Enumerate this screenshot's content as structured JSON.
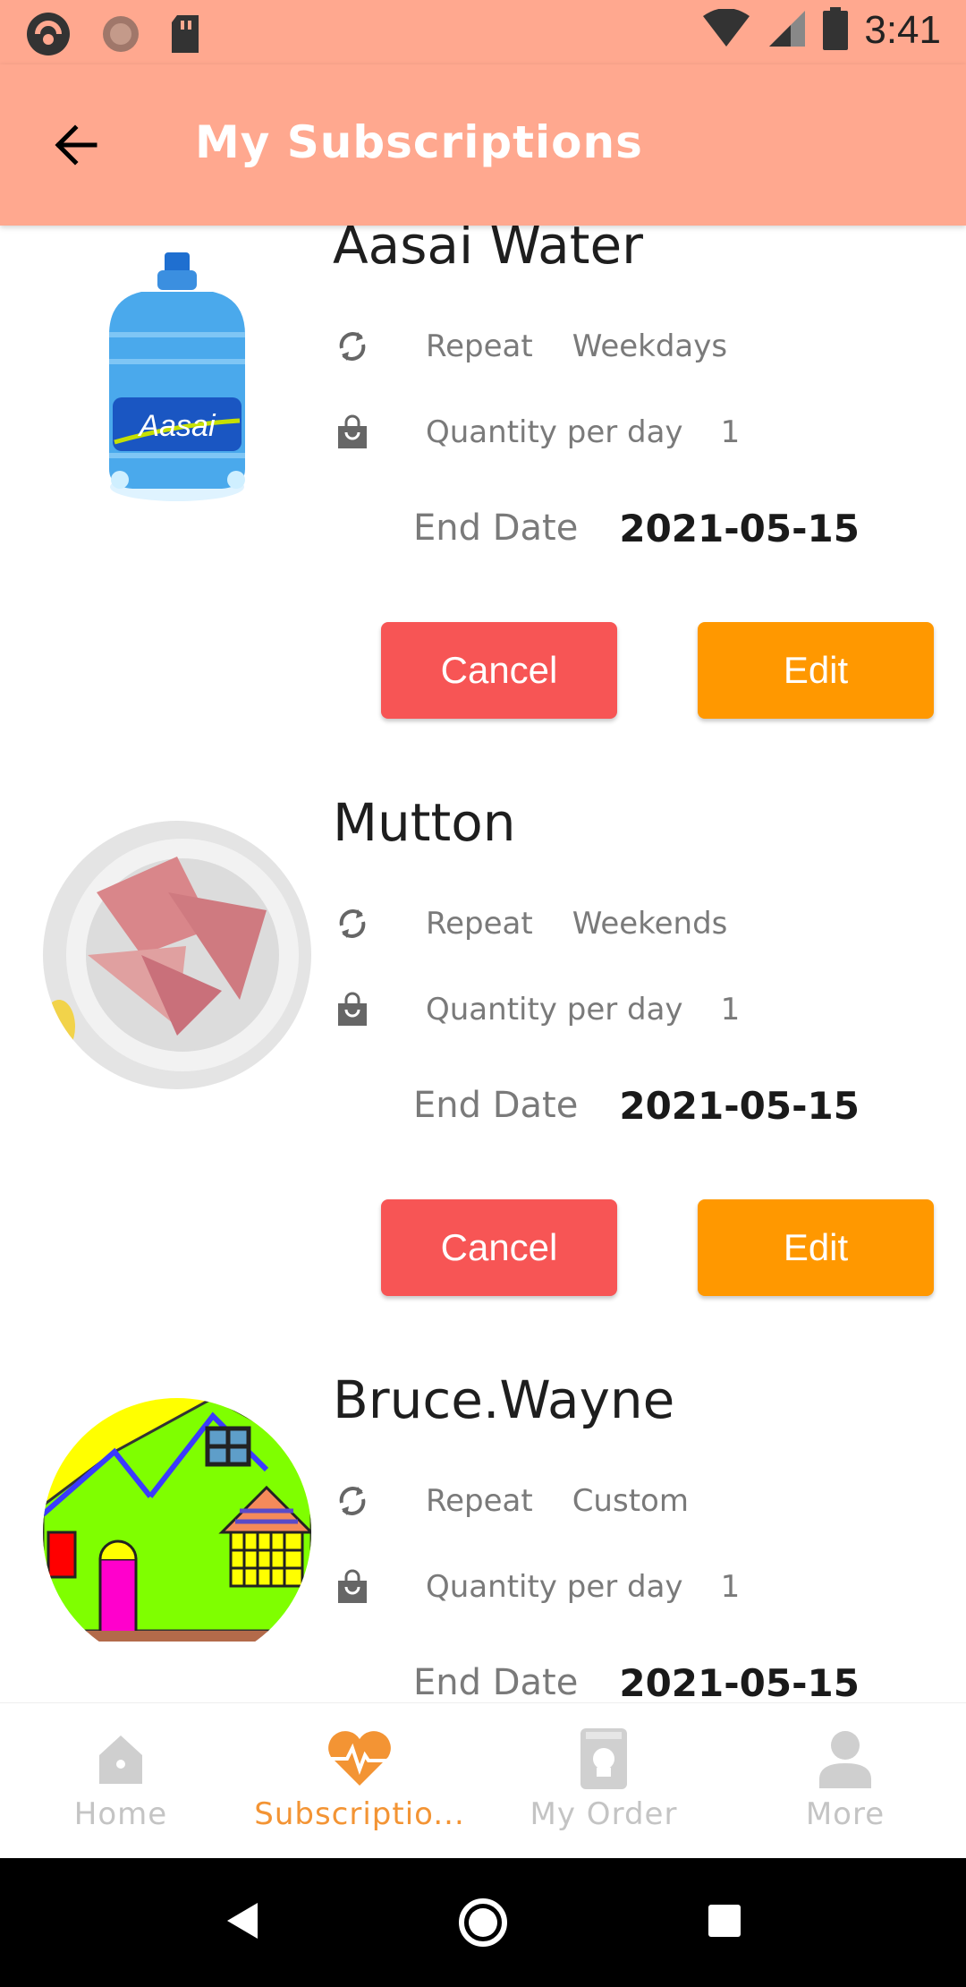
{
  "status_bar": {
    "time": "3:41",
    "icons": [
      "app-icon",
      "circle-dot-icon",
      "sd-card-icon",
      "wifi-icon",
      "signal-icon",
      "battery-icon"
    ]
  },
  "header": {
    "title": "My Subscriptions",
    "back_icon": "arrow-left-icon"
  },
  "subscriptions": [
    {
      "name": "Aasai Water",
      "image_label": "Aasai",
      "repeat_label": "Repeat",
      "repeat_value": "Weekdays",
      "qty_label": "Quantity per day",
      "qty_value": "1",
      "end_label": "End Date",
      "end_value": "2021-05-15",
      "cancel_label": "Cancel",
      "edit_label": "Edit"
    },
    {
      "name": "Mutton",
      "repeat_label": "Repeat",
      "repeat_value": "Weekends",
      "qty_label": "Quantity per day",
      "qty_value": "1",
      "end_label": "End Date",
      "end_value": "2021-05-15",
      "cancel_label": "Cancel",
      "edit_label": "Edit"
    },
    {
      "name": "Bruce.Wayne",
      "repeat_label": "Repeat",
      "repeat_value": "Custom",
      "qty_label": "Quantity per day",
      "qty_value": "1",
      "end_label": "End Date",
      "end_value": "2021-05-15"
    }
  ],
  "bottom_nav": {
    "items": [
      {
        "label": "Home",
        "icon": "home-icon",
        "active": false
      },
      {
        "label": "Subscriptio...",
        "icon": "heart-pulse-icon",
        "active": true
      },
      {
        "label": "My Order",
        "icon": "order-book-icon",
        "active": false
      },
      {
        "label": "More",
        "icon": "person-icon",
        "active": false
      }
    ]
  },
  "colors": {
    "app_bar": "#FFA88F",
    "cancel": "#F75555",
    "edit": "#FF9800",
    "active_tab": "#F39434",
    "inactive_tab": "#C4C4C4"
  },
  "system_nav": {
    "icons": [
      "back-triangle-icon",
      "home-circle-icon",
      "recents-square-icon"
    ]
  }
}
